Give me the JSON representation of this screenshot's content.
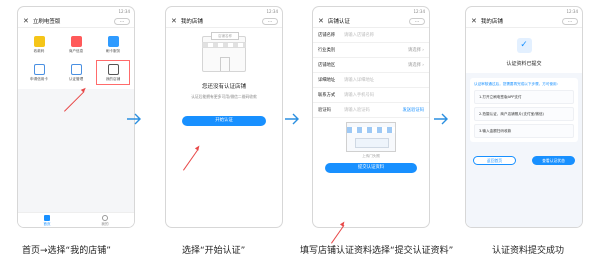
{
  "colors": {
    "accent": "#1890ff",
    "highlight": "#e84848"
  },
  "status": {
    "left": "",
    "right": "12:34"
  },
  "screen1": {
    "title": "立刷电签版",
    "more": "···",
    "tiles": [
      {
        "label": "收款码",
        "color": "#f5c518",
        "icon": "qr-icon"
      },
      {
        "label": "商户信息",
        "color": "#ff5a5a",
        "icon": "merchant-icon"
      },
      {
        "label": "刷卡服务",
        "color": "#2f9bff",
        "icon": "card-icon"
      },
      {
        "label": "申请信用卡",
        "color": "#4a90e2",
        "icon": "creditcard-icon"
      },
      {
        "label": "认证管理",
        "color": "#4a90e2",
        "icon": "cert-icon"
      },
      {
        "label": "我的店铺",
        "color": "#555555",
        "icon": "shop-icon"
      }
    ],
    "tabs": [
      {
        "label": "首页",
        "icon": "home-icon"
      },
      {
        "label": "我的",
        "icon": "user-icon"
      }
    ],
    "caption": "首页→选择“我的店铺”"
  },
  "screen2": {
    "title": "我的店铺",
    "more": "···",
    "sign": "店铺名称",
    "empty_title": "您还没有认证店铺",
    "empty_desc": "认证后能拥有更多可用/微信二维码收款",
    "button": "开始认证",
    "caption": "选择“开始认证”"
  },
  "screen3": {
    "title": "店铺认证",
    "more": "···",
    "rows": [
      {
        "key": "店铺名称",
        "value": "请输入店铺名称",
        "right": ""
      },
      {
        "key": "行业类别",
        "value": "",
        "right": "请选择 ›"
      },
      {
        "key": "店铺地区",
        "value": "",
        "right": "请选择 ›"
      },
      {
        "key": "详细地址",
        "value": "请输入详细地址",
        "right": ""
      },
      {
        "key": "联系方式",
        "value": "请输入手机号码",
        "right": ""
      },
      {
        "key": "验证码",
        "value": "请输入验证码",
        "right": "发送验证码"
      }
    ],
    "upload": "上传门头照",
    "button": "提交认证资料",
    "caption": "填写店铺认证资料选择“提交认证资料”"
  },
  "screen4": {
    "title": "我的店铺",
    "more": "···",
    "done": "认证资料已提交",
    "panel_head": "认证审核通过后，您需要再完成以下步骤，方可使用：",
    "steps": [
      "1.打开立刷电签版APP支付",
      "2.拍摄认证、商户店铺照片(支付宝/微信)",
      "3.输入金额扫码收款"
    ],
    "btn_outline": "返回首页",
    "btn_fill": "查看认证状态",
    "caption": "认证资料提交成功"
  }
}
